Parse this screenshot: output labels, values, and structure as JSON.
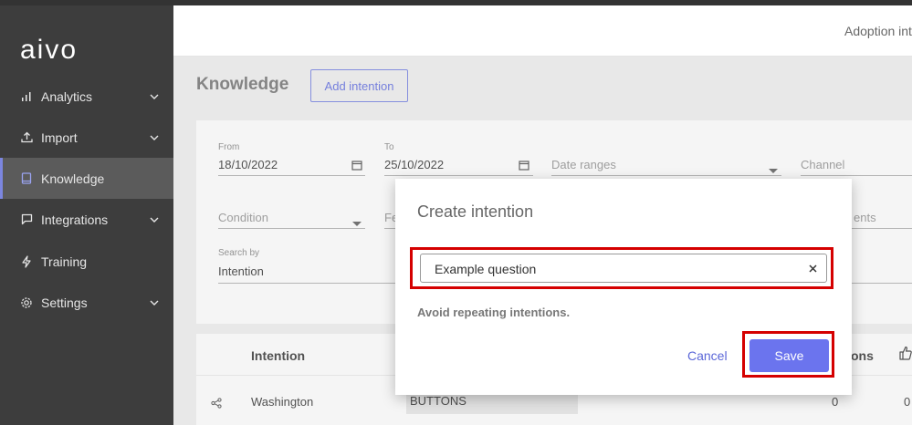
{
  "app": {
    "logo_text": "aivo"
  },
  "sidebar": {
    "items": [
      {
        "label": "Analytics",
        "icon": "bar-chart-icon",
        "expandable": true
      },
      {
        "label": "Import",
        "icon": "upload-icon",
        "expandable": true
      },
      {
        "label": "Knowledge",
        "icon": "book-icon",
        "expandable": false,
        "active": true
      },
      {
        "label": "Integrations",
        "icon": "chat-icon",
        "expandable": true
      },
      {
        "label": "Training",
        "icon": "bolt-icon",
        "expandable": false
      },
      {
        "label": "Settings",
        "icon": "gear-icon",
        "expandable": true
      }
    ]
  },
  "header": {
    "right_text": "Adoption int"
  },
  "page": {
    "title": "Knowledge",
    "add_button": "Add intention"
  },
  "filters": {
    "from_label": "From",
    "from_value": "18/10/2022",
    "to_label": "To",
    "to_value": "25/10/2022",
    "date_ranges_placeholder": "Date ranges",
    "channel_placeholder": "Channel",
    "condition_placeholder": "Condition",
    "partial_placeholder_left": "Fe",
    "partial_placeholder_right": "ents",
    "search_by_label": "Search by",
    "search_by_value": "Intention"
  },
  "table": {
    "headers": {
      "intention": "Intention",
      "right_partial": "ons"
    },
    "rows": [
      {
        "intention": "Washington",
        "type": "BUTTONS",
        "count": "0",
        "likes": "0"
      }
    ]
  },
  "modal": {
    "title": "Create intention",
    "input_value": "Example question",
    "hint": "Avoid repeating intentions.",
    "cancel_label": "Cancel",
    "save_label": "Save"
  },
  "colors": {
    "accent": "#6b74ee",
    "highlight": "#d50000",
    "sidebar_bg": "#3d3d3d",
    "sidebar_active": "#5b5b5b"
  }
}
